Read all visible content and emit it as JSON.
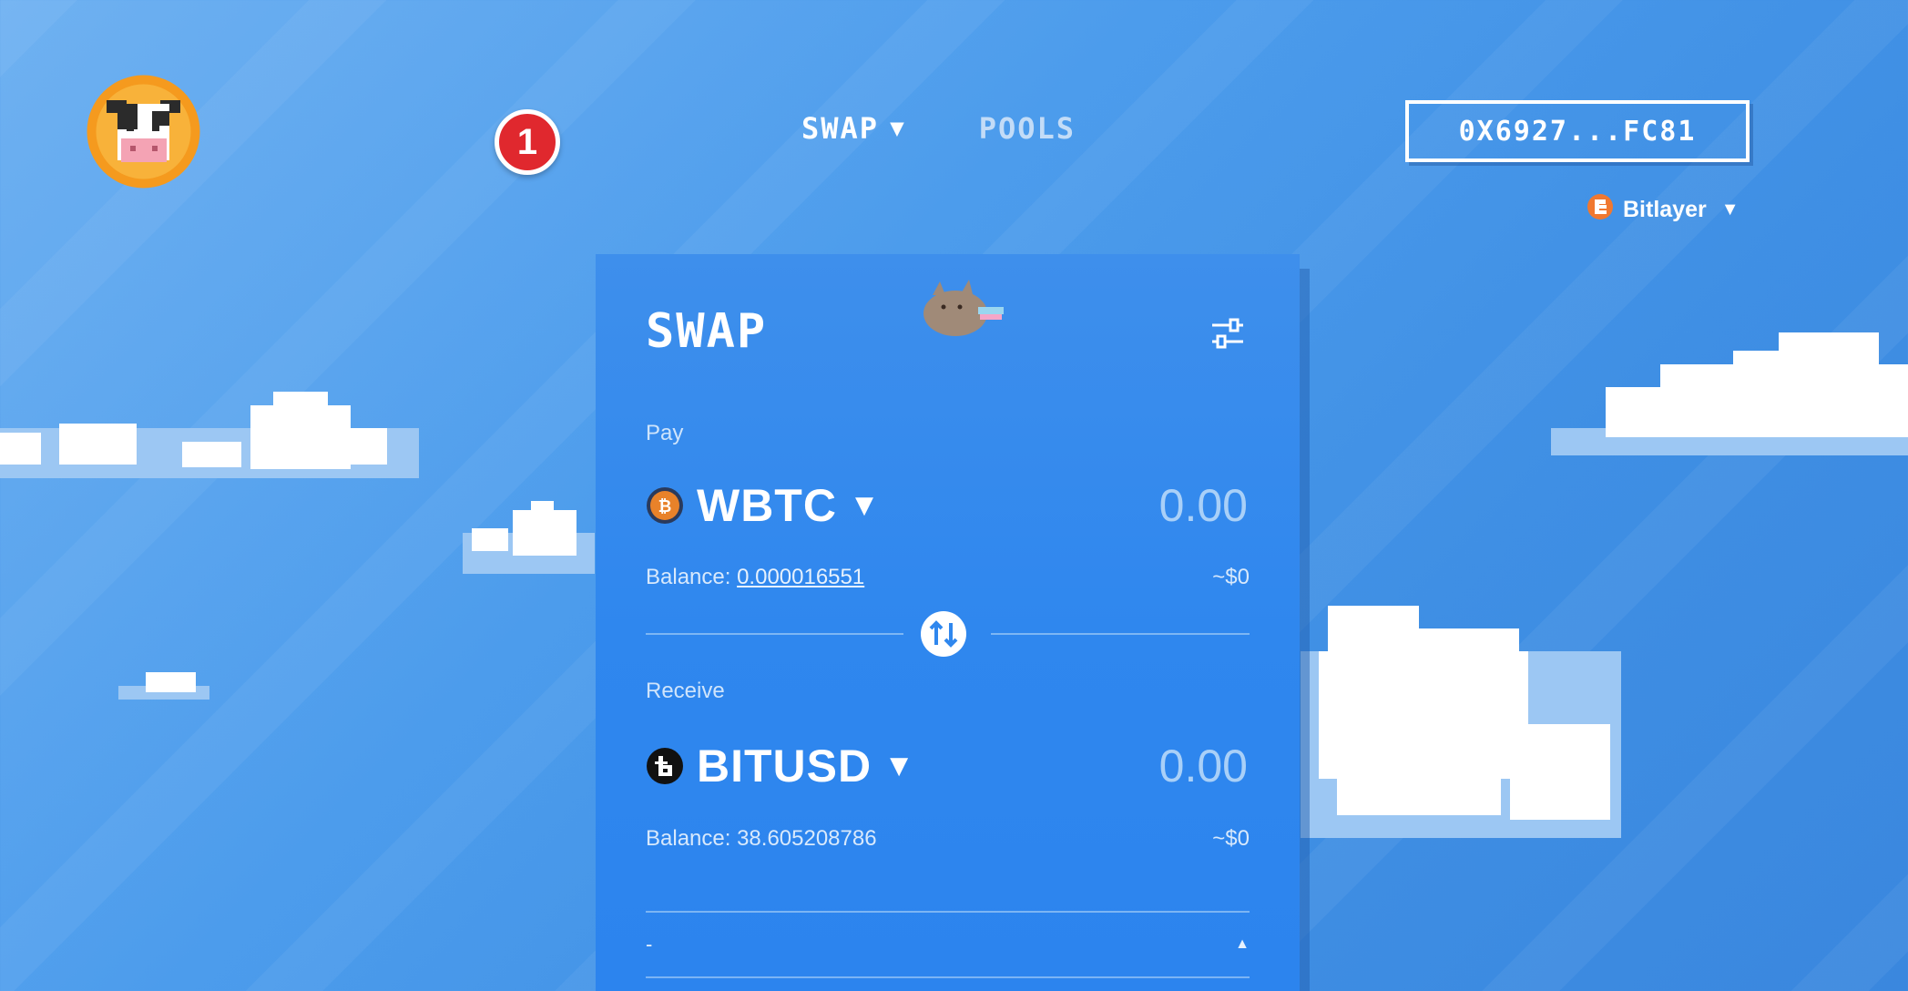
{
  "header": {
    "notification_count": "1",
    "nav": [
      {
        "label": "SWAP"
      },
      {
        "label": "POOLS"
      }
    ],
    "wallet_address": "0X6927...FC81",
    "network": "Bitlayer"
  },
  "swap": {
    "title": "SWAP",
    "pay": {
      "label": "Pay",
      "token": "WBTC",
      "amount_placeholder": "0.00",
      "balance_label": "Balance:",
      "balance_value": "0.000016551",
      "usd": "~$0"
    },
    "receive": {
      "label": "Receive",
      "token": "BITUSD",
      "amount_placeholder": "0.00",
      "balance_label": "Balance:",
      "balance_value": "38.605208786",
      "usd": "~$0"
    },
    "footer_text": "-"
  },
  "colors": {
    "accent_bg": "#4c9cec",
    "card_bg": "#2f87ee",
    "notification_red": "#e0282e",
    "wbtc_orange": "#e8822a",
    "network_orange": "#f07830"
  }
}
